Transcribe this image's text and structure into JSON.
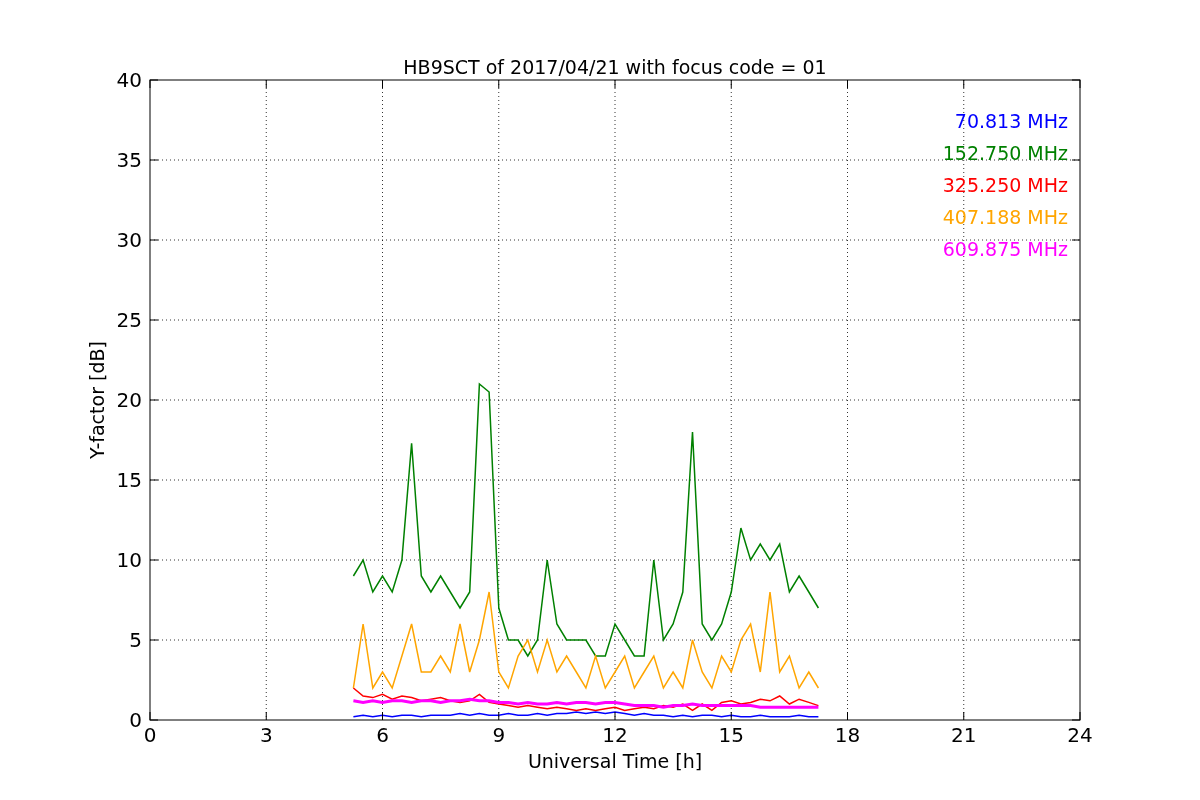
{
  "chart_data": {
    "type": "line",
    "title": "HB9SCT of 2017/04/21 with focus code = 01",
    "xlabel": "Universal Time [h]",
    "ylabel": "Y-factor [dB]",
    "x": [
      5.25,
      5.5,
      5.75,
      6,
      6.25,
      6.5,
      6.75,
      7,
      7.25,
      7.5,
      7.75,
      8,
      8.25,
      8.5,
      8.75,
      9,
      9.25,
      9.5,
      9.75,
      10,
      10.25,
      10.5,
      10.75,
      11,
      11.25,
      11.5,
      11.75,
      12,
      12.25,
      12.5,
      12.75,
      13,
      13.25,
      13.5,
      13.75,
      14,
      14.25,
      14.5,
      14.75,
      15,
      15.25,
      15.5,
      15.75,
      16,
      16.25,
      16.5,
      16.75,
      17,
      17.25
    ],
    "grid": true,
    "xlim": [
      0,
      24
    ],
    "ylim": [
      0,
      40
    ],
    "xticks": [
      0,
      3,
      6,
      9,
      12,
      15,
      18,
      21,
      24
    ],
    "yticks": [
      0,
      5,
      10,
      15,
      20,
      25,
      30,
      35,
      40
    ],
    "series": [
      {
        "name": "70.813 MHz",
        "color": "#0000ff",
        "values": [
          0.2,
          0.3,
          0.2,
          0.3,
          0.2,
          0.3,
          0.3,
          0.2,
          0.3,
          0.3,
          0.3,
          0.4,
          0.3,
          0.4,
          0.3,
          0.3,
          0.4,
          0.3,
          0.3,
          0.4,
          0.3,
          0.4,
          0.4,
          0.5,
          0.4,
          0.5,
          0.4,
          0.5,
          0.4,
          0.3,
          0.4,
          0.3,
          0.3,
          0.2,
          0.3,
          0.2,
          0.3,
          0.3,
          0.2,
          0.3,
          0.2,
          0.2,
          0.3,
          0.2,
          0.2,
          0.2,
          0.3,
          0.2,
          0.2
        ]
      },
      {
        "name": "152.750 MHz",
        "color": "#008000",
        "values": [
          9,
          10,
          8,
          9,
          8,
          10,
          17.3,
          9,
          8,
          9,
          8,
          7,
          8,
          21,
          20.5,
          7,
          5,
          5,
          4,
          5,
          10,
          6,
          5,
          5,
          5,
          4,
          4,
          6,
          5,
          4,
          4,
          10,
          5,
          6,
          8,
          18,
          6,
          5,
          6,
          8,
          12,
          10,
          11,
          10,
          11,
          8,
          9,
          8,
          7
        ]
      },
      {
        "name": "325.250 MHz",
        "color": "#ff0000",
        "values": [
          2,
          1.5,
          1.4,
          1.6,
          1.3,
          1.5,
          1.4,
          1.2,
          1.3,
          1.4,
          1.2,
          1.1,
          1.2,
          1.6,
          1.1,
          1.0,
          0.9,
          0.8,
          0.9,
          0.8,
          0.7,
          0.8,
          0.7,
          0.6,
          0.7,
          0.6,
          0.7,
          0.8,
          0.6,
          0.7,
          0.8,
          0.7,
          0.9,
          0.8,
          1.0,
          0.6,
          1.0,
          0.6,
          1.1,
          1.2,
          1.0,
          1.1,
          1.3,
          1.2,
          1.5,
          1.0,
          1.3,
          1.1,
          0.9
        ]
      },
      {
        "name": "407.188 MHz",
        "color": "#ffa500",
        "values": [
          2,
          6,
          2,
          3,
          2,
          4,
          6,
          3,
          3,
          4,
          3,
          6,
          3,
          5,
          8,
          3,
          2,
          4,
          5,
          3,
          5,
          3,
          4,
          3,
          2,
          4,
          2,
          3,
          4,
          2,
          3,
          4,
          2,
          3,
          2,
          5,
          3,
          2,
          4,
          3,
          5,
          6,
          3,
          8,
          3,
          4,
          2,
          3,
          2
        ]
      },
      {
        "name": "609.875 MHz",
        "color": "#ff00ff",
        "values": [
          1.2,
          1.1,
          1.2,
          1.1,
          1.2,
          1.2,
          1.1,
          1.2,
          1.2,
          1.1,
          1.2,
          1.2,
          1.3,
          1.2,
          1.2,
          1.1,
          1.1,
          1.0,
          1.1,
          1.0,
          1.0,
          1.1,
          1.0,
          1.1,
          1.1,
          1.0,
          1.1,
          1.1,
          1.0,
          0.9,
          0.9,
          0.9,
          0.8,
          0.9,
          0.9,
          1.0,
          0.9,
          0.9,
          0.9,
          0.9,
          0.9,
          0.9,
          0.8,
          0.8,
          0.8,
          0.8,
          0.8,
          0.8,
          0.8
        ]
      }
    ]
  }
}
